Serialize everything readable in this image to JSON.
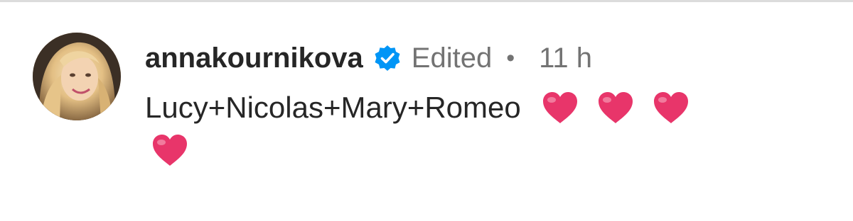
{
  "post": {
    "username": "annakournikova",
    "verified_icon": "verified-badge-icon",
    "edited_label": "Edited",
    "separator": "•",
    "timestamp": "11 h",
    "caption_text": "Lucy+Nicolas+Mary+Romeo",
    "emoji": [
      "red-heart",
      "red-heart",
      "red-heart",
      "red-heart"
    ]
  },
  "colors": {
    "text_primary": "#262626",
    "text_secondary": "#737373",
    "verified_blue": "#0095f6",
    "heart": "#e8356a"
  }
}
